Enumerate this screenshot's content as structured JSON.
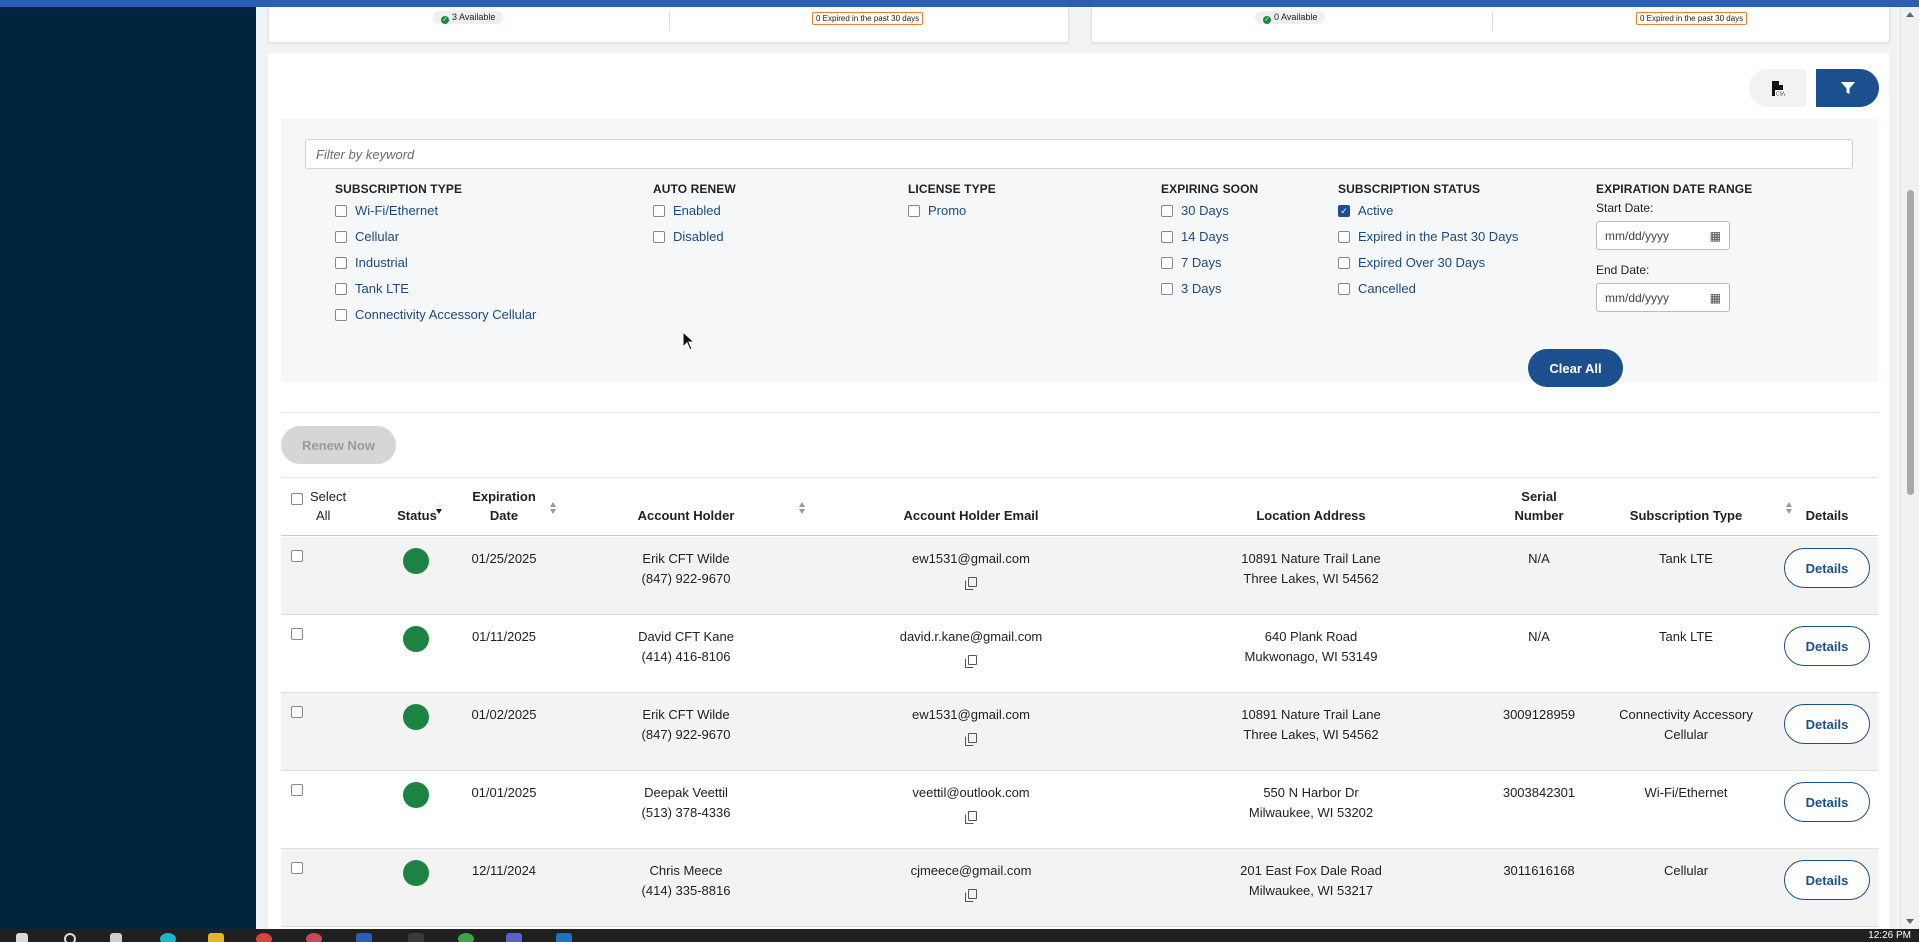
{
  "clock": "12:26 PM",
  "summary_cards": [
    {
      "available": "3 Available",
      "expired": "0 Expired in the past 30 days"
    },
    {
      "available": "0 Available",
      "expired": "0 Expired in the past 30 days"
    }
  ],
  "toolbar": {
    "csv_icon": "csv-file-icon",
    "filter_icon": "filter-funnel-icon"
  },
  "filters": {
    "keyword_placeholder": "Filter by keyword",
    "subscription_type": {
      "title": "SUBSCRIPTION TYPE",
      "options": [
        "Wi-Fi/Ethernet",
        "Cellular",
        "Industrial",
        "Tank LTE",
        "Connectivity Accessory Cellular"
      ]
    },
    "auto_renew": {
      "title": "AUTO RENEW",
      "options": [
        "Enabled",
        "Disabled"
      ]
    },
    "license_type": {
      "title": "LICENSE TYPE",
      "options": [
        "Promo"
      ]
    },
    "expiring_soon": {
      "title": "EXPIRING SOON",
      "options": [
        "30 Days",
        "14 Days",
        "7 Days",
        "3 Days"
      ]
    },
    "subscription_status": {
      "title": "SUBSCRIPTION STATUS",
      "options": [
        "Active",
        "Expired in the Past 30 Days",
        "Expired Over 30 Days",
        "Cancelled"
      ],
      "checked": [
        "Active"
      ]
    },
    "expiration_date_range": {
      "title": "EXPIRATION DATE RANGE",
      "start_label": "Start Date:",
      "end_label": "End Date:",
      "start_placeholder": "mm/dd/yyyy",
      "end_placeholder": "mm/dd/yyyy"
    },
    "clear_all": "Clear All"
  },
  "renew_now": "Renew Now",
  "table": {
    "headers": {
      "select_all_1": "Select",
      "select_all_2": "All",
      "status": "Status",
      "expiration_1": "Expiration",
      "expiration_2": "Date",
      "account_holder": "Account Holder",
      "email": "Account Holder Email",
      "location": "Location Address",
      "serial_1": "Serial",
      "serial_2": "Number",
      "subscription_type": "Subscription Type",
      "details": "Details"
    },
    "rows": [
      {
        "date": "01/25/2025",
        "name": "Erik CFT Wilde",
        "phone": "(847) 922-9670",
        "email": "ew1531@gmail.com",
        "addr1": "10891 Nature Trail Lane",
        "addr2": "Three Lakes, WI 54562",
        "serial": "N/A",
        "type1": "Tank LTE",
        "type2": "",
        "details": "Details"
      },
      {
        "date": "01/11/2025",
        "name": "David CFT Kane",
        "phone": "(414) 416-8106",
        "email": "david.r.kane@gmail.com",
        "addr1": "640 Plank Road",
        "addr2": "Mukwonago, WI 53149",
        "serial": "N/A",
        "type1": "Tank LTE",
        "type2": "",
        "details": "Details"
      },
      {
        "date": "01/02/2025",
        "name": "Erik CFT Wilde",
        "phone": "(847) 922-9670",
        "email": "ew1531@gmail.com",
        "addr1": "10891 Nature Trail Lane",
        "addr2": "Three Lakes, WI 54562",
        "serial": "3009128959",
        "type1": "Connectivity Accessory",
        "type2": "Cellular",
        "details": "Details"
      },
      {
        "date": "01/01/2025",
        "name": "Deepak Veettil",
        "phone": "(513) 378-4336",
        "email": "veettil@outlook.com",
        "addr1": "550 N Harbor Dr",
        "addr2": "Milwaukee, WI 53202",
        "serial": "3003842301",
        "type1": "Wi-Fi/Ethernet",
        "type2": "",
        "details": "Details"
      },
      {
        "date": "12/11/2024",
        "name": "Chris Meece",
        "phone": "(414) 335-8816",
        "email": "cjmeece@gmail.com",
        "addr1": "201 East Fox Dale Road",
        "addr2": "Milwaukee, WI 53217",
        "serial": "3011616168",
        "type1": "Cellular",
        "type2": "",
        "details": "Details"
      }
    ]
  },
  "colors": {
    "primary": "#1b4f8d",
    "sidebar": "#02253f",
    "status_active": "#1c8343",
    "expired_border": "#e8812a"
  }
}
